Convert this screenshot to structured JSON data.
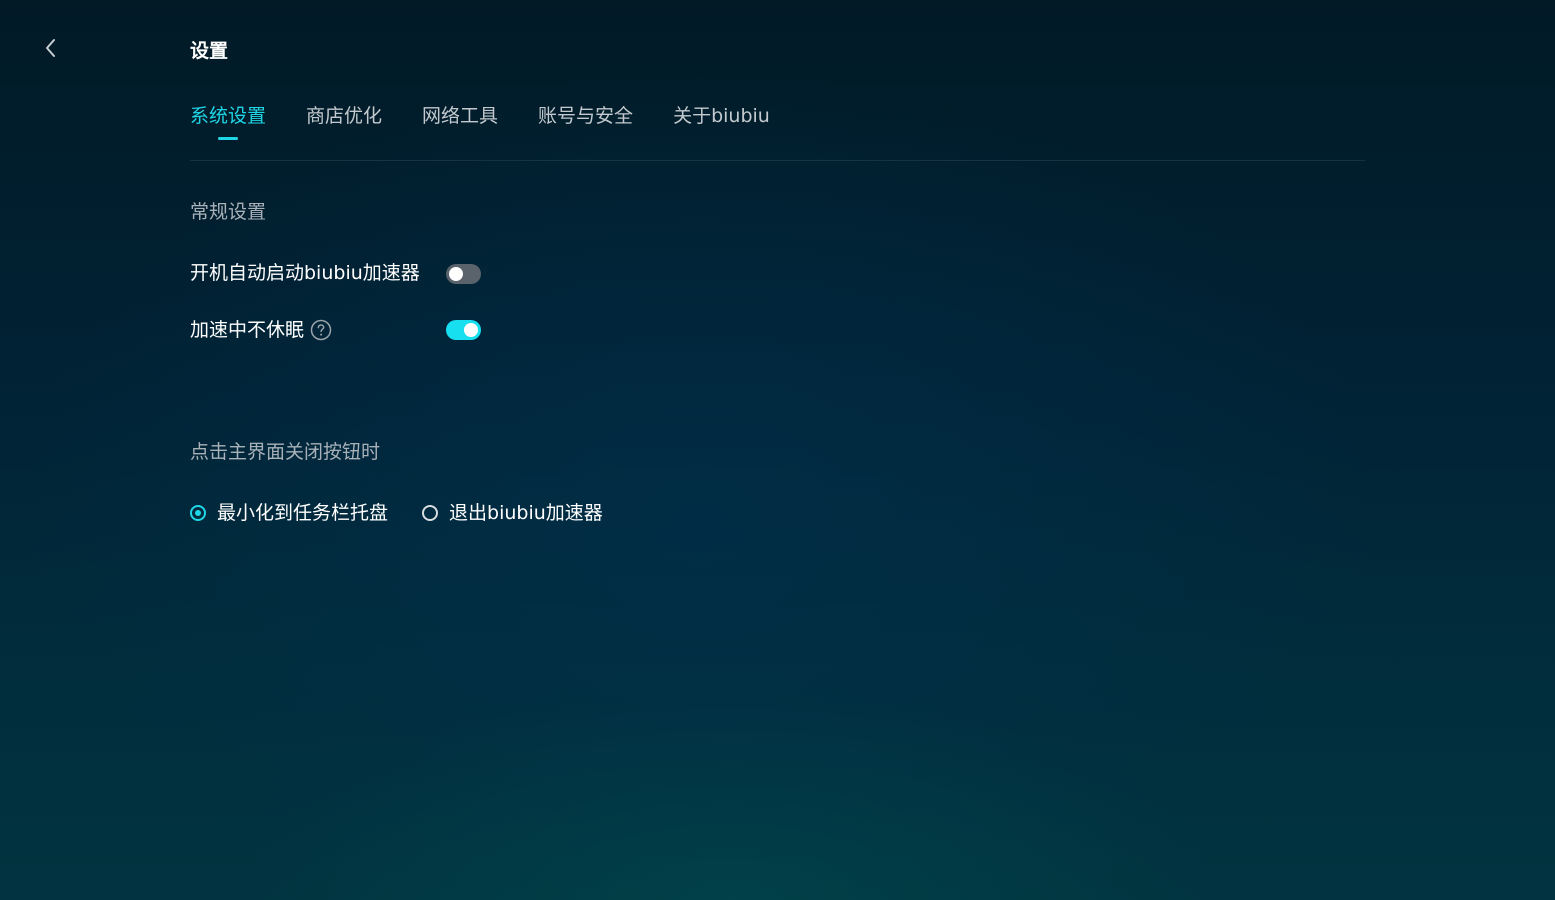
{
  "header": {
    "back_icon": "chevron-left-icon",
    "title": "设置"
  },
  "tabs": [
    {
      "label": "系统设置",
      "active": true
    },
    {
      "label": "商店优化",
      "active": false
    },
    {
      "label": "网络工具",
      "active": false
    },
    {
      "label": "账号与安全",
      "active": false
    },
    {
      "label": "关于biubiu",
      "active": false
    }
  ],
  "general": {
    "title": "常规设置",
    "items": [
      {
        "label": "开机自动启动biubiu加速器",
        "enabled": false
      },
      {
        "label": "加速中不休眠",
        "enabled": true,
        "help_icon": "question-circle-icon"
      }
    ]
  },
  "close_behavior": {
    "title": "点击主界面关闭按钮时",
    "options": [
      {
        "label": "最小化到任务栏托盘",
        "selected": true
      },
      {
        "label": "退出biubiu加速器",
        "selected": false
      }
    ]
  },
  "colors": {
    "accent": "#1ed6e6",
    "toggle_off": "#5a636b"
  }
}
